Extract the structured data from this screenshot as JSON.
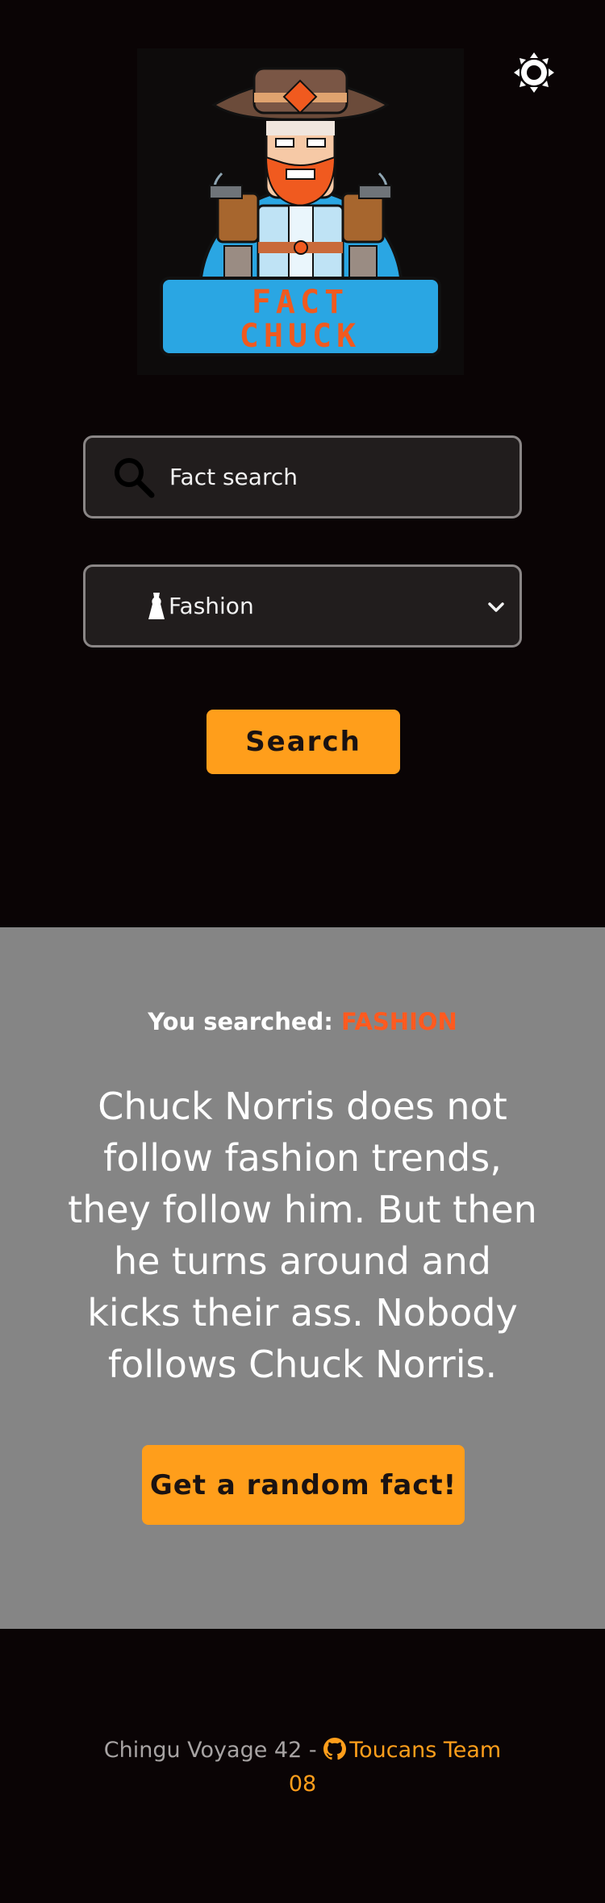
{
  "header": {
    "theme_toggle_icon": "sun-icon",
    "logo": {
      "text_line1": "FACT",
      "text_line2": "CHUCK"
    }
  },
  "search": {
    "placeholder": "Fact search",
    "icon": "search-icon"
  },
  "category": {
    "icon": "dress-icon",
    "selected": "Fashion"
  },
  "search_button_label": "Search",
  "result": {
    "searched_label": "You searched:",
    "searched_term": "FASHION",
    "fact": "Chuck Norris does not follow fashion trends, they follow him. But then he turns around and kicks their ass. Nobody follows Chuck Norris.",
    "random_button_label": "Get a random fact!"
  },
  "footer": {
    "prefix": "Chingu Voyage 42 -",
    "link_icon": "github-icon",
    "link_text": "Toucans Team 08"
  },
  "colors": {
    "background": "#0a0405",
    "accent": "#ff9e1b",
    "highlight": "#ff5a1f",
    "result_bg": "#858585"
  }
}
